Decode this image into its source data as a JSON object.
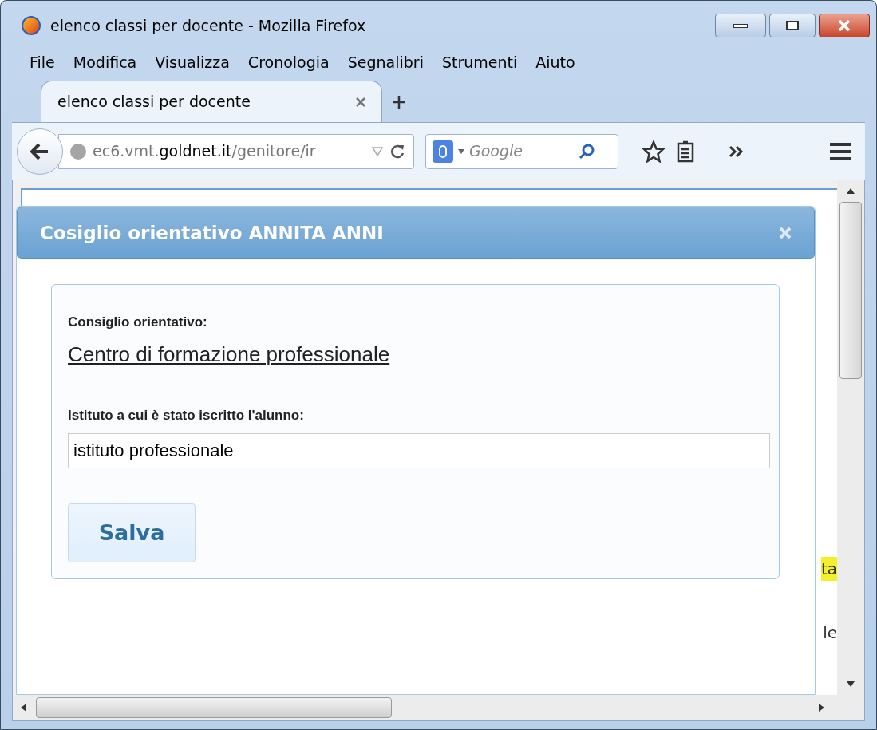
{
  "window": {
    "title": "elenco classi per docente - Mozilla Firefox"
  },
  "menu": [
    {
      "key": "F",
      "after": "ile"
    },
    {
      "key": "M",
      "after": "odifica"
    },
    {
      "key": "V",
      "after": "isualizza"
    },
    {
      "key": "C",
      "after": "ronologia"
    },
    {
      "before": "S",
      "key": "e",
      "after": "gnalibri"
    },
    {
      "key": "S",
      "after": "trumenti"
    },
    {
      "key": "A",
      "after": "iuto"
    }
  ],
  "tabs": [
    {
      "label": "elenco classi per docente",
      "selected": true
    }
  ],
  "address_bar": {
    "url": "ec6.vmt.**goldnet.it**/genitore/ir"
  },
  "search": {
    "placeholder": "Google"
  },
  "page_fragments": [
    {
      "text": "ta",
      "highlighted": true
    },
    {
      "text": "le",
      "highlighted": false
    }
  ],
  "dialog": {
    "title": "Cosiglio orientativo ANNITA ANNI",
    "advice_label": "Consiglio orientativo:",
    "advice_value": "Centro di formazione professionale",
    "school_label": "Istituto a cui è stato iscritto l'alunno:",
    "school_value": "istituto professionale",
    "save_button": "Salva"
  }
}
